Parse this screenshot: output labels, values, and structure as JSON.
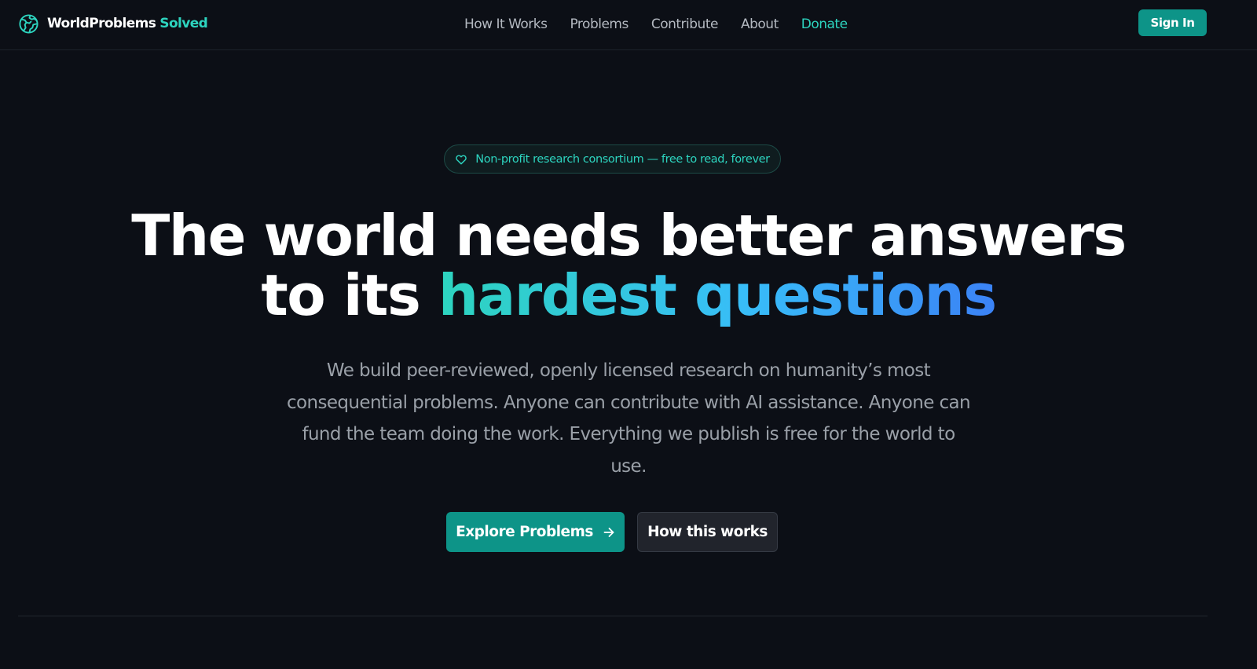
{
  "brand": {
    "name": "WorldProblems",
    "accent": "Solved",
    "icon": "globe-logo-icon",
    "accent_color": "#2dd4bf"
  },
  "nav": {
    "links": [
      "How It Works",
      "Problems",
      "Contribute",
      "About",
      "Donate"
    ],
    "sign_in_label": "Sign In"
  },
  "hero": {
    "badge_icon": "heart-icon",
    "badge_text": "Non-profit research consortium — free to read, forever",
    "headline_line1": "The world needs better answers",
    "headline_line2_prefix": "to its",
    "headline_line2_highlight": "hardest questions",
    "subtext": "We build peer-reviewed, openly licensed research on humanity’s most consequential problems. Anyone can contribute with AI assistance. Anyone can fund the team doing the work. Everything we publish is free for the world to use.",
    "primary_cta": "Explore Problems",
    "primary_cta_icon": "arrow-right-icon",
    "secondary_cta": "How this works"
  },
  "colors": {
    "background": "#0c0f16",
    "primary": "#0d9488",
    "teal": "#2dd4bf",
    "blue": "#3b82f6"
  }
}
